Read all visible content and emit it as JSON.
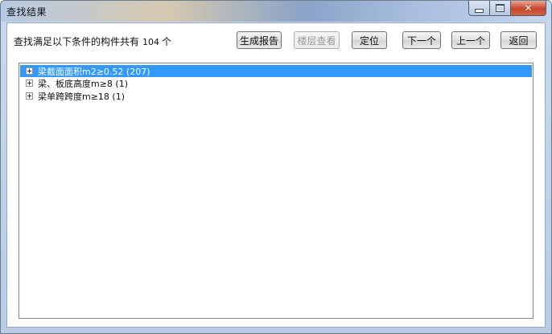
{
  "window": {
    "title": "查找结果"
  },
  "summary": {
    "text": "查找满足以下条件的构件共有",
    "count": "104",
    "unit": "个"
  },
  "toolbar": {
    "report_label": "生成报告",
    "floor_view_label": "楼层查看",
    "locate_label": "定位",
    "next_label": "下一个",
    "prev_label": "上一个",
    "back_label": "返回"
  },
  "tree": {
    "items": [
      {
        "label": "梁截面面积m2≥0.52 (207)",
        "selected": true
      },
      {
        "label": "梁、板底高度m≥8 (1)",
        "selected": false
      },
      {
        "label": "梁单跨跨度m≥18 (1)",
        "selected": false
      }
    ]
  },
  "icons": {
    "minimize": "minimize-icon",
    "maximize": "maximize-icon",
    "close": "close-icon",
    "expander": "plus-box-icon"
  },
  "colors": {
    "selection": "#3399ff",
    "close_button": "#c5472c"
  }
}
